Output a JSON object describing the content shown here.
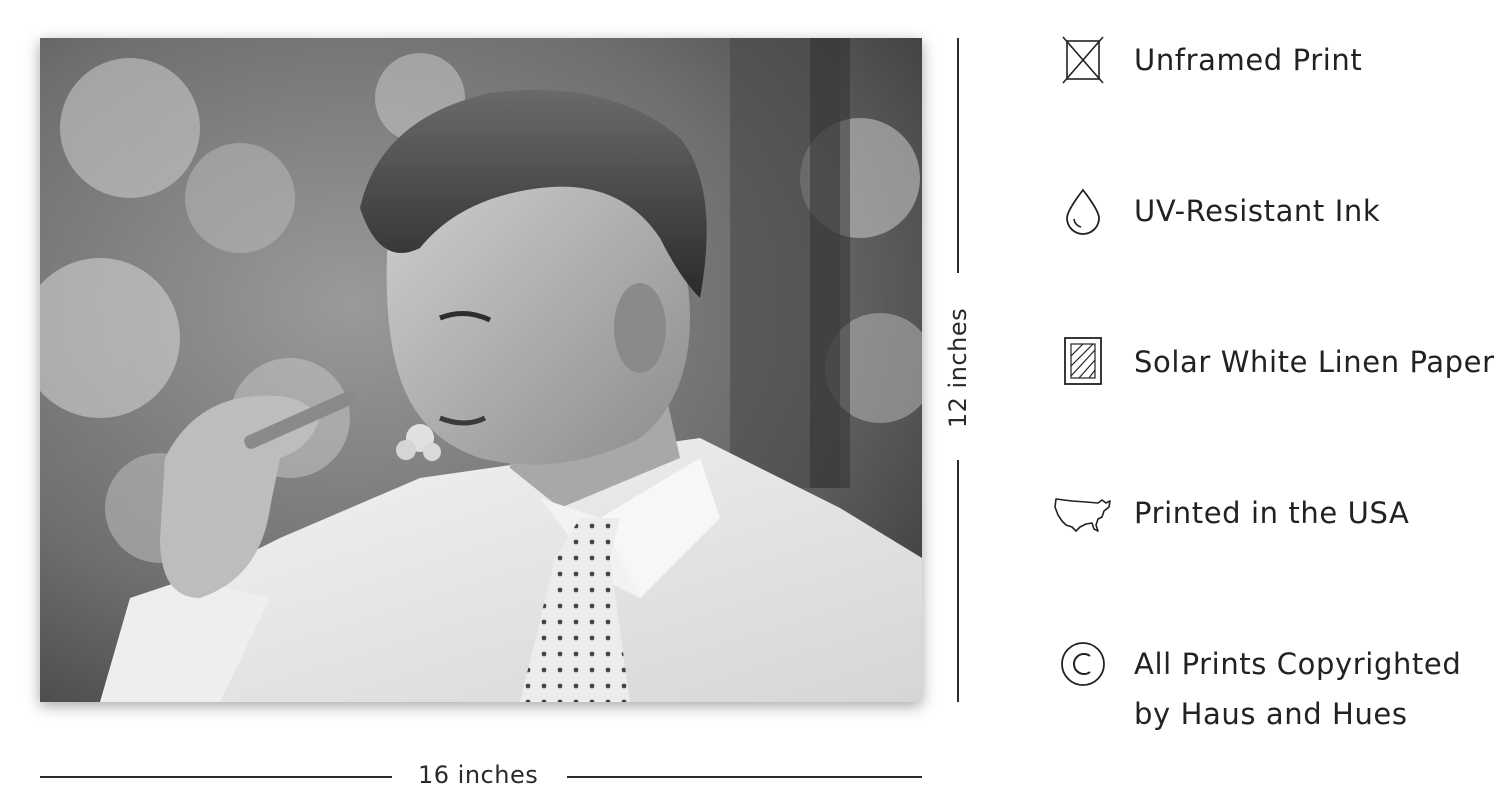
{
  "dimensions": {
    "width_label": "16 inches",
    "height_label": "12 inches"
  },
  "features": [
    {
      "icon": "unframed-icon",
      "lines": [
        "Unframed Print"
      ]
    },
    {
      "icon": "ink-drop-icon",
      "lines": [
        "UV-Resistant Ink"
      ]
    },
    {
      "icon": "paper-icon",
      "lines": [
        "Solar White Linen Paper"
      ]
    },
    {
      "icon": "usa-map-icon",
      "lines": [
        "Printed in the USA"
      ]
    },
    {
      "icon": "copyright-icon",
      "lines": [
        "All Prints Copyrighted",
        "by Haus and Hues"
      ]
    }
  ],
  "colors": {
    "text": "#222222",
    "line": "#2a2a2a"
  }
}
